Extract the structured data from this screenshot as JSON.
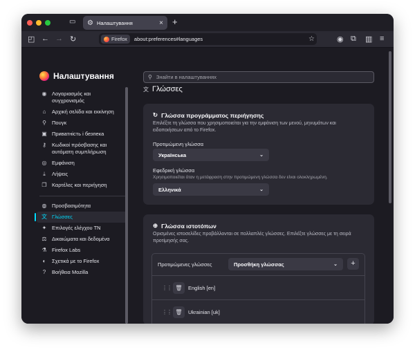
{
  "window": {
    "colors": {
      "close": "#ff5f57",
      "minimize": "#febc2e",
      "maximize": "#28c840",
      "accent": "#00ddff"
    }
  },
  "tab": {
    "title": "Налаштування",
    "icon": "gear-icon"
  },
  "urlbar": {
    "badge": "Firefox",
    "url": "about:preferences#languages"
  },
  "sidebar": {
    "title": "Налаштування",
    "items": [
      {
        "label": "Λογαριασμός και συγχρονισμός",
        "icon": "account-icon"
      },
      {
        "label": "Αρχική σελίδα και εκκίνηση",
        "icon": "home-icon"
      },
      {
        "label": "Πουγκ",
        "icon": "search-icon"
      },
      {
        "label": "Приватність і безпека",
        "icon": "lock-icon"
      },
      {
        "label": "Κωδικοί πρόσβασης και αυτόματη συμπλήρωση",
        "icon": "key-icon"
      },
      {
        "label": "Εμφάνιση",
        "icon": "eye-icon"
      },
      {
        "label": "Λήψεις",
        "icon": "download-icon"
      },
      {
        "label": "Καρτέλες και περιήγηση",
        "icon": "tabs-icon"
      }
    ],
    "items2": [
      {
        "label": "Προσβασιμότητα",
        "icon": "accessibility-icon"
      },
      {
        "label": "Γλώσσες",
        "icon": "translate-icon"
      },
      {
        "label": "Επιλογές ελέγχου ΤΝ",
        "icon": "ai-icon"
      },
      {
        "label": "Δικαιώματα και δεδομένα",
        "icon": "permissions-icon"
      },
      {
        "label": "Firefox Labs",
        "icon": "flask-icon"
      },
      {
        "label": "Σχετικά με το Firefox",
        "icon": "firefox-icon"
      },
      {
        "label": "Βοήθεια Mozilla",
        "icon": "help-icon"
      }
    ]
  },
  "search": {
    "placeholder": "Знайти в налаштуваннях"
  },
  "main": {
    "heading": "Γλώσσες",
    "browser_language": {
      "title": "Γλώσσα προγράμματος περιήγησης",
      "description": "Επιλέξτε τη γλώσσα που χρησιμοποιείται για την εμφάνιση των μενού, μηνυμάτων και ειδοποιήσεων από το Firefox.",
      "preferred_label": "Προτιμώμενη γλώσσα",
      "preferred_value": "Українська",
      "fallback_label": "Εφεδρική γλώσσα",
      "fallback_help": "Χρησιμοποιείται όταν η μετάφραση στην προτιμώμενη γλώσσα δεν είναι ολοκληρωμένη.",
      "fallback_value": "Ελληνικά"
    },
    "website_language": {
      "title": "Γλώσσα ιστοτόπων",
      "description": "Ορισμένες ιστοσελίδες προβάλλονται σε πολλαπλές γλώσσες. Επιλέξτε γλώσσες με τη σειρά προτίμησής σας.",
      "table_label": "Προτιμώμενες γλώσσες",
      "add_select": "Προσθήκη γλώσσας",
      "languages": [
        "English [en]",
        "Ukrainian [uk]"
      ]
    }
  }
}
